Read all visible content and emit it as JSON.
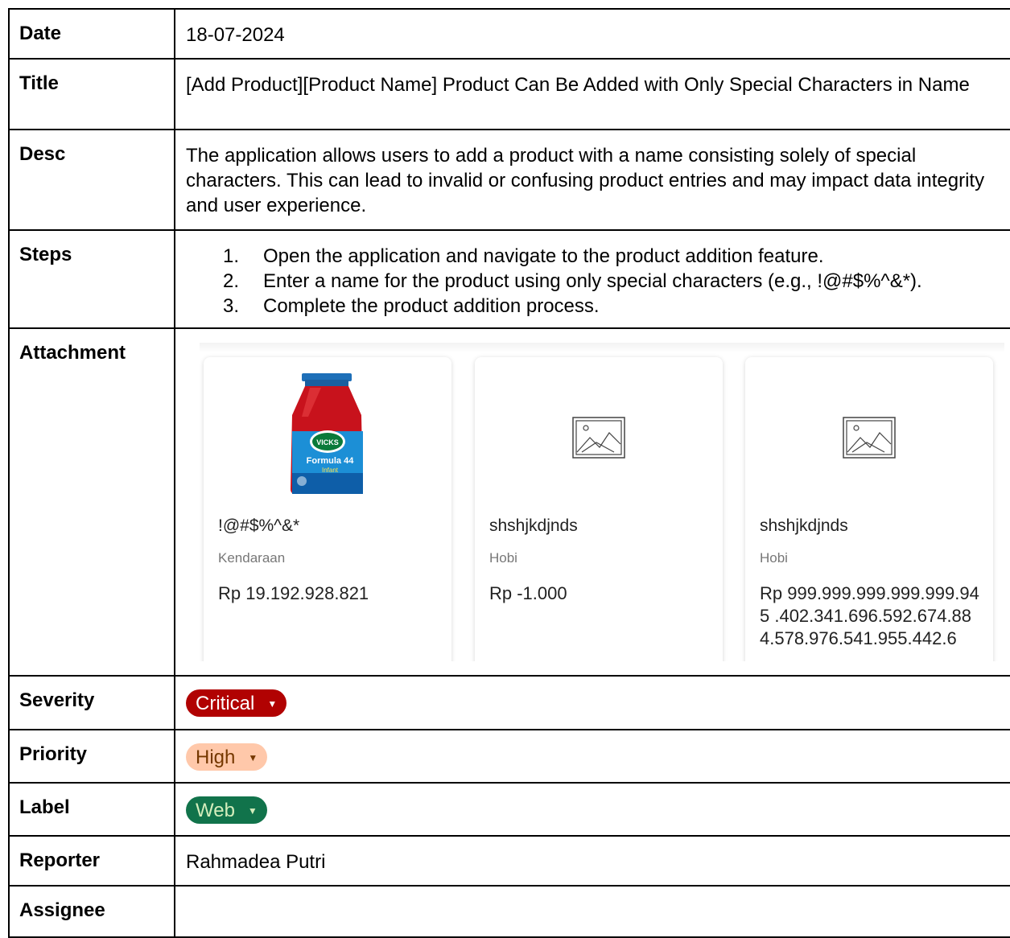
{
  "rows": {
    "date": {
      "label": "Date",
      "value": "18-07-2024"
    },
    "title": {
      "label": "Title",
      "value": "[Add Product][Product Name] Product Can Be Added with Only Special Characters in Name"
    },
    "desc": {
      "label": "Desc",
      "value": "The application allows users to add a product with a name consisting solely of special characters. This can lead to invalid or confusing product entries and may impact data integrity and user experience."
    },
    "steps": {
      "label": "Steps",
      "items": [
        {
          "num": "1.",
          "text": "Open the application and navigate to the product addition feature."
        },
        {
          "num": "2.",
          "text": "Enter a name for the product using only special characters (e.g., !@#$%^&*)."
        },
        {
          "num": "3.",
          "text": "Complete the product addition process."
        }
      ]
    },
    "attachment": {
      "label": "Attachment",
      "cards": [
        {
          "name": "!@#$%^&*",
          "category": "Kendaraan",
          "price": "Rp 19.192.928.821",
          "image": "medicine-bottle"
        },
        {
          "name": "shshjkdjnds",
          "category": "Hobi",
          "price": "Rp -1.000",
          "image": "placeholder-image-icon"
        },
        {
          "name": "shshjkdjnds",
          "category": "Hobi",
          "price": "Rp 999.999.999.999.999.945 .402.341.696.592.674.88 4.578.976.541.955.442.6",
          "image": "placeholder-image-icon"
        }
      ],
      "bottle_text": {
        "brand": "VICKS",
        "product": "Formula 44",
        "sub": "Infant"
      }
    },
    "severity": {
      "label": "Severity",
      "value": "Critical",
      "color": "#b10202"
    },
    "priority": {
      "label": "Priority",
      "value": "High",
      "color": "#ffc8aa"
    },
    "label": {
      "label": "Label",
      "value": "Web",
      "color": "#11734b"
    },
    "reporter": {
      "label": "Reporter",
      "value": "Rahmadea Putri"
    },
    "assignee": {
      "label": "Assignee",
      "value": ""
    }
  }
}
